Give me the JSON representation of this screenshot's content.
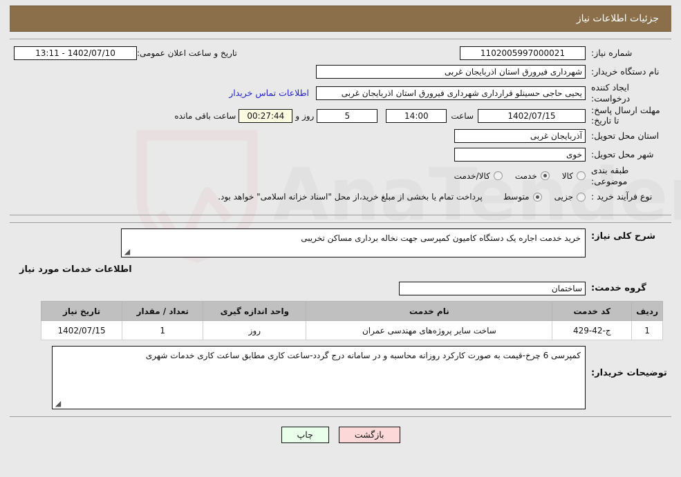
{
  "header": {
    "title": "جزئیات اطلاعات نیاز"
  },
  "colors": {
    "header_bg": "#8a6f4a",
    "header_text": "#ffffff",
    "link": "#2222cc",
    "timer_bg": "#fbfbe2",
    "table_header_bg": "#c0c0c0",
    "print_button_bg": "#eaffea",
    "back_button_bg": "#fcd8d8",
    "page_bg": "#e9e9e9"
  },
  "form": {
    "need_number_label": "شماره نیاز:",
    "need_number_value": "1102005997000021",
    "announce_label": "تاریخ و ساعت اعلان عمومی:",
    "announce_value": "1402/07/10 - 13:11",
    "buyer_org_label": "نام دستگاه خریدار:",
    "buyer_org_value": "شهرداری فیرورق استان اذربایجان غربی",
    "creator_label": "ایجاد کننده درخواست:",
    "creator_value": "یحیی حاجی حسینلو قرارداری شهرداری فیرورق استان اذربایجان غربی",
    "contact_link": "اطلاعات تماس خریدار",
    "deadline_label": "مهلت ارسال پاسخ: تا تاریخ:",
    "deadline_date": "1402/07/15",
    "deadline_hour_label": "ساعت",
    "deadline_hour": "14:00",
    "remaining_days": "5",
    "remaining_days_sep": "روز و",
    "remaining_timer": "00:27:44",
    "remaining_suffix": "ساعت باقی مانده",
    "province_label": "استان محل تحویل:",
    "province_value": "آذربایجان غربی",
    "city_label": "شهر محل تحویل:",
    "city_value": "خوی",
    "classification_label": "طبقه بندی موضوعی:",
    "classification_options": [
      {
        "label": "کالا",
        "selected": false
      },
      {
        "label": "خدمت",
        "selected": true
      },
      {
        "label": "کالا/خدمت",
        "selected": false
      }
    ],
    "process_label": "نوع فرآیند خرید :",
    "process_options": [
      {
        "label": "جزیی",
        "selected": false
      },
      {
        "label": "متوسط",
        "selected": true
      }
    ],
    "process_note": "پرداخت تمام یا بخشی از مبلغ خرید،از محل \"اسناد خزانه اسلامی\" خواهد بود."
  },
  "description": {
    "label": "شرح کلی نیاز:",
    "value": "خرید خدمت اجاره یک دستگاه کامیون کمپرسی جهت نخاله برداری مساکن تخریبی"
  },
  "services_section": {
    "title": "اطلاعات خدمات مورد نیاز",
    "group_label": "گروه خدمت:",
    "group_value": "ساختمان"
  },
  "table": {
    "columns": [
      "ردیف",
      "کد خدمت",
      "نام خدمت",
      "واحد اندازه گیری",
      "تعداد / مقدار",
      "تاریخ نیاز"
    ],
    "rows": [
      [
        "1",
        "ج-42-429",
        "ساخت سایر پروژه‌های مهندسی عمران",
        "روز",
        "1",
        "1402/07/15"
      ]
    ]
  },
  "buyer_notes": {
    "label": "توضیحات خریدار:",
    "value": "کمپرسی 6 چرخ-قیمت به صورت کارکرد روزانه محاسبه و در سامانه درج گردد-ساعت کاری مطابق ساعت کاری خدمات شهری"
  },
  "footer": {
    "print_label": "چاپ",
    "back_label": "بازگشت"
  },
  "watermark": {
    "text": "AnaTender.net"
  }
}
